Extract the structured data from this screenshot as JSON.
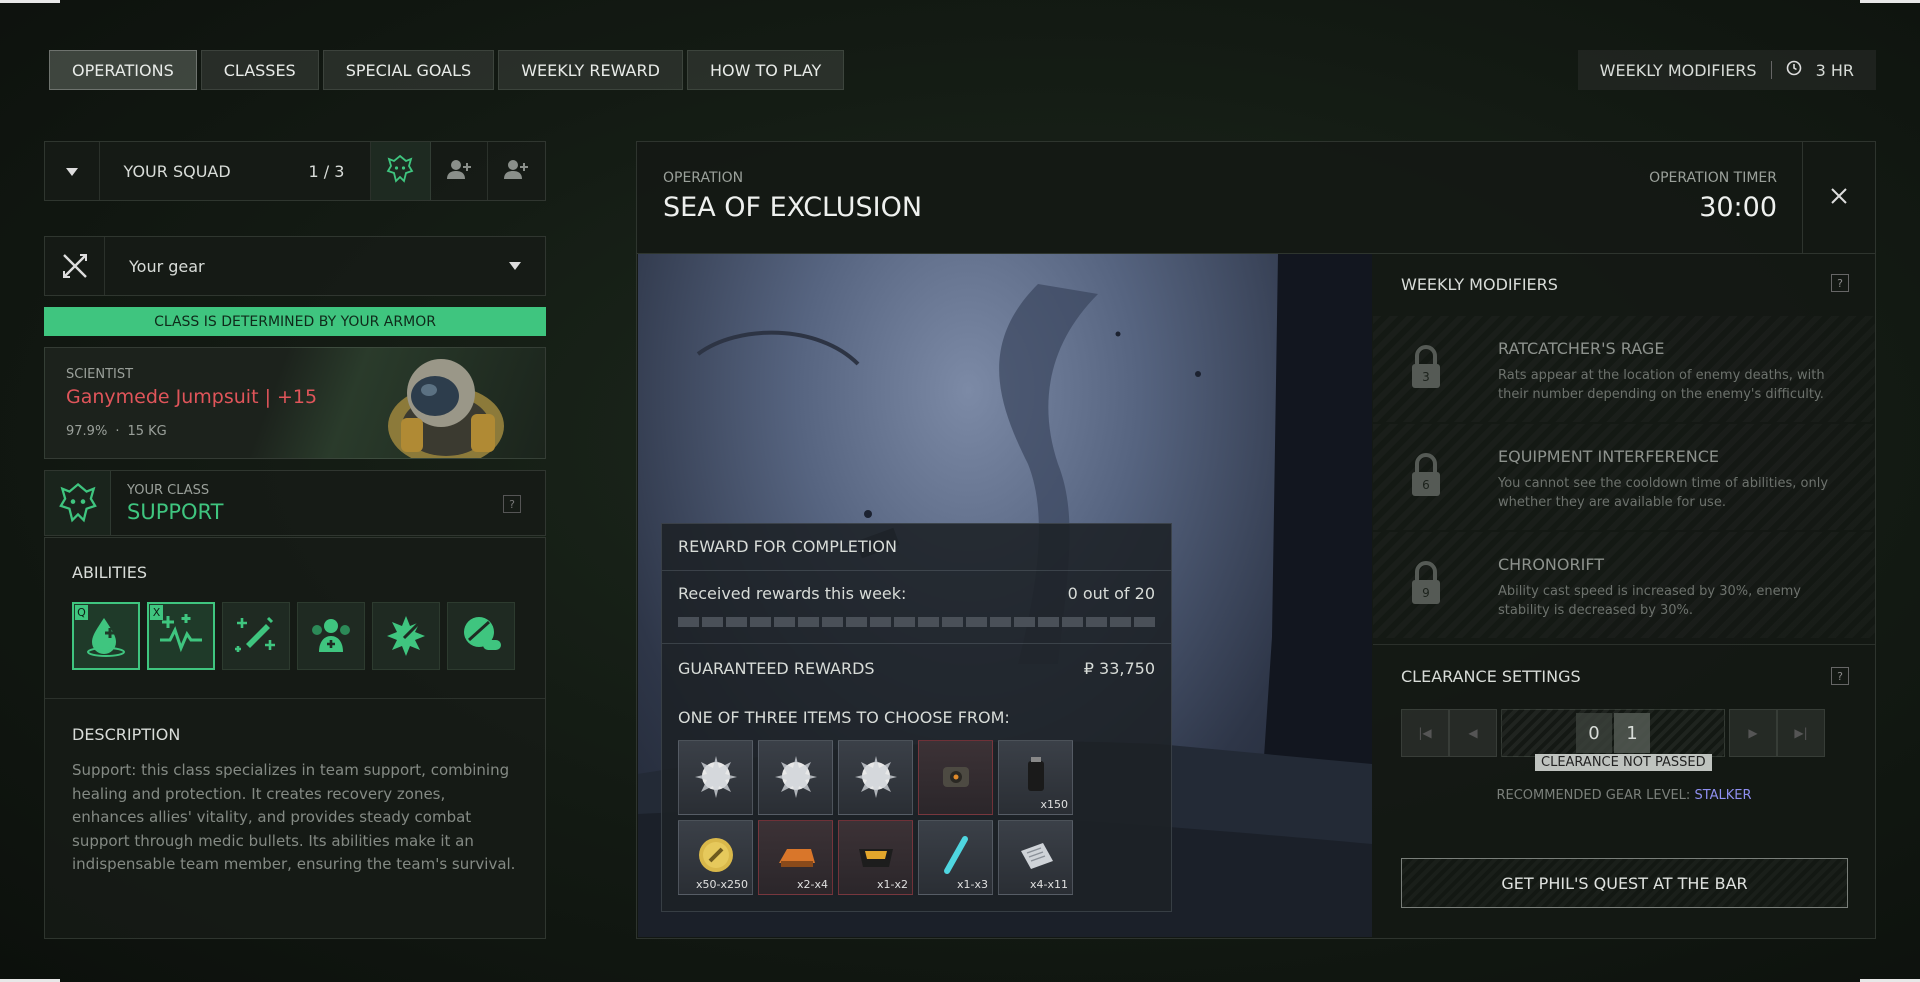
{
  "tabs": [
    "OPERATIONS",
    "CLASSES",
    "SPECIAL GOALS",
    "WEEKLY REWARD",
    "HOW TO PLAY"
  ],
  "header": {
    "weekly_modifiers": "WEEKLY MODIFIERS",
    "time": "3 HR"
  },
  "squad": {
    "label": "YOUR SQUAD",
    "count": "1 / 3"
  },
  "gear": {
    "label": "Your gear"
  },
  "class_bar": "CLASS IS DETERMINED BY YOUR ARMOR",
  "armor": {
    "type": "SCIENTIST",
    "name": "Ganymede Jumpsuit | +15",
    "durability": "97.9%",
    "weight": "15 KG"
  },
  "your_class": {
    "label": "YOUR CLASS",
    "value": "SUPPORT"
  },
  "abilities": {
    "title": "ABILITIES",
    "key_q": "Q",
    "key_x": "X"
  },
  "description": {
    "title": "DESCRIPTION",
    "text": "Support: this class specializes in team support, combining healing and protection. It creates recovery zones, enhances allies' vitality, and provides steady combat support through medic bullets. Its abilities make it an indispensable team member, ensuring the team's survival."
  },
  "operation": {
    "label": "OPERATION",
    "name": "SEA OF EXCLUSION",
    "timer_label": "OPERATION TIMER",
    "timer": "30:00"
  },
  "reward": {
    "title": "REWARD FOR COMPLETION",
    "received_label": "Received rewards this week:",
    "received_value": "0 out of 20",
    "progress": 0,
    "guaranteed_label": "GUARANTEED REWARDS",
    "guaranteed_value": "₽ 33,750",
    "choose_label": "ONE OF THREE ITEMS TO CHOOSE FROM:",
    "items": [
      {
        "qty": ""
      },
      {
        "qty": ""
      },
      {
        "qty": ""
      },
      {
        "qty": ""
      },
      {
        "qty": "x150"
      },
      {
        "qty": "x50-x250"
      },
      {
        "qty": "x2-x4"
      },
      {
        "qty": "x1-x2"
      },
      {
        "qty": "x1-x3"
      },
      {
        "qty": "x4-x11"
      }
    ]
  },
  "modifiers": {
    "title": "WEEKLY MODIFIERS",
    "help": "?",
    "list": [
      {
        "level": "3",
        "name": "RATCATCHER'S RAGE",
        "desc": "Rats appear at the location of enemy deaths, with their number depending on the enemy's difficulty."
      },
      {
        "level": "6",
        "name": "EQUIPMENT INTERFERENCE",
        "desc": "You cannot see the cooldown time of abilities, only whether they are available for use."
      },
      {
        "level": "9",
        "name": "CHRONORIFT",
        "desc": "Ability cast speed is increased by 30%, enemy stability is decreased by 30%."
      }
    ]
  },
  "clearance": {
    "title": "CLEARANCE SETTINGS",
    "help": "?",
    "digits": [
      "0",
      "1"
    ],
    "status": "CLEARANCE NOT PASSED",
    "rec_label": "RECOMMENDED GEAR LEVEL:",
    "rec_value": "STALKER"
  },
  "quest_button": "GET PHIL'S QUEST AT THE BAR",
  "class_help": "?",
  "colors": {
    "accent": "#3fc57f",
    "armor_name": "#e0555a",
    "stalker": "#8f8ff0"
  }
}
